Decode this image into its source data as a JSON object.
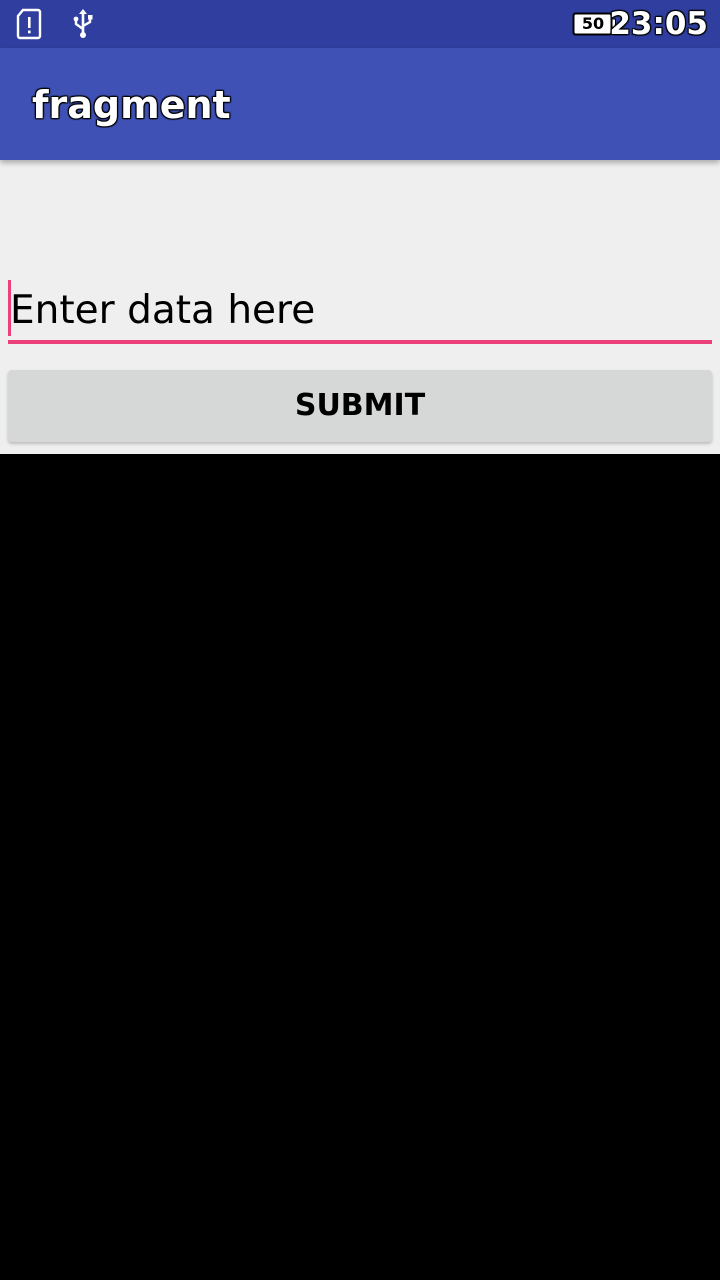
{
  "status_bar": {
    "icons": [
      "sd-card-alert-icon",
      "usb-icon",
      "battery-icon"
    ],
    "battery_level": "50",
    "time": "23:05",
    "background_color": "#303f9f"
  },
  "app_bar": {
    "title": "fragment",
    "background_color": "#3f51b5"
  },
  "form": {
    "input": {
      "placeholder": "Enter data here",
      "value": "",
      "accent_color": "#ec407a"
    },
    "submit_label": "SUBMIT"
  }
}
